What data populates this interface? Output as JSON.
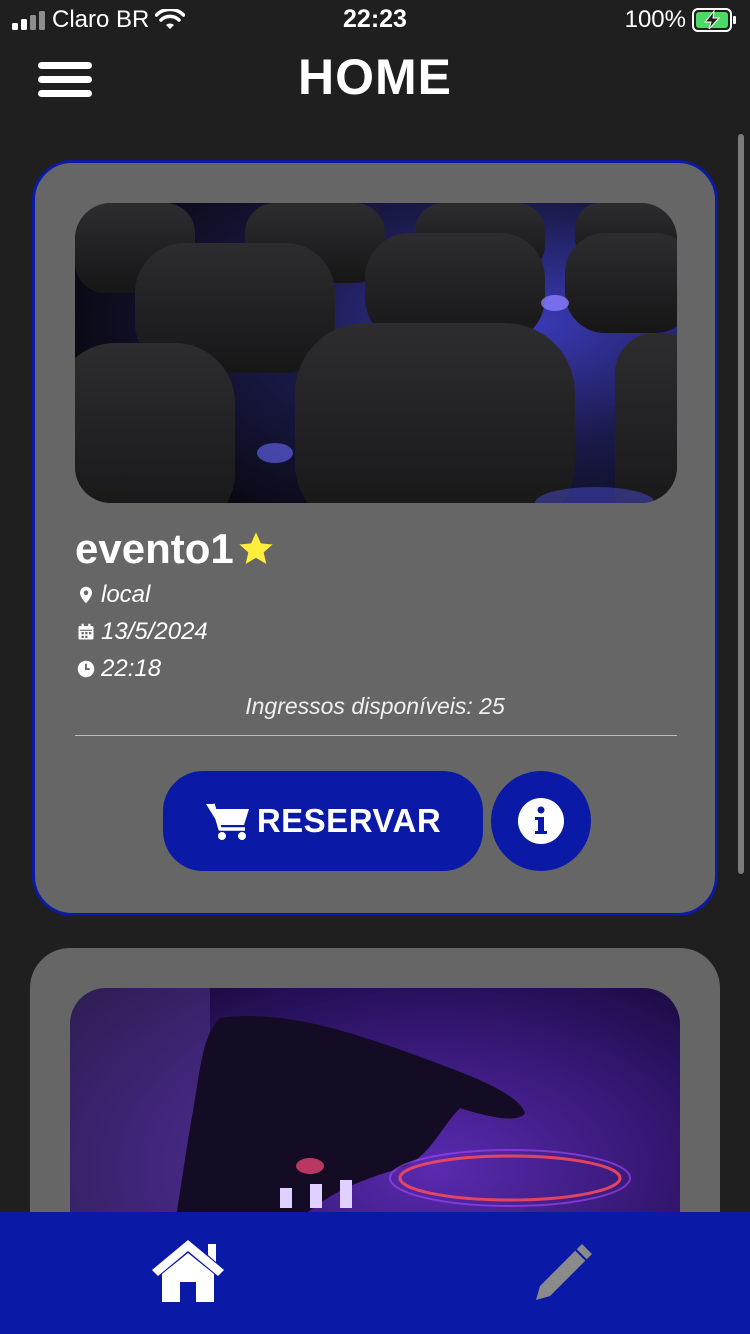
{
  "status_bar": {
    "carrier": "Claro BR",
    "time": "22:23",
    "battery": "100%"
  },
  "header": {
    "title": "HOME",
    "menu_icon": "hamburger-menu-icon"
  },
  "events": [
    {
      "name": "evento1",
      "favorite": true,
      "location": "local",
      "date": "13/5/2024",
      "time": "22:18",
      "tickets": "Ingressos disponíveis: 25",
      "reserve_label": "RESERVAR",
      "image": "auditorium-chairs-photo"
    },
    {
      "image": "dj-mixer-photo"
    }
  ],
  "bottom_nav": {
    "items": [
      {
        "icon": "home-icon",
        "active": true
      },
      {
        "icon": "pencil-icon",
        "active": false
      }
    ]
  },
  "colors": {
    "background": "#1f1f1f",
    "card": "#666666",
    "accent": "#0a1aa6",
    "star": "#ffee3b",
    "battery": "#4cd964"
  }
}
